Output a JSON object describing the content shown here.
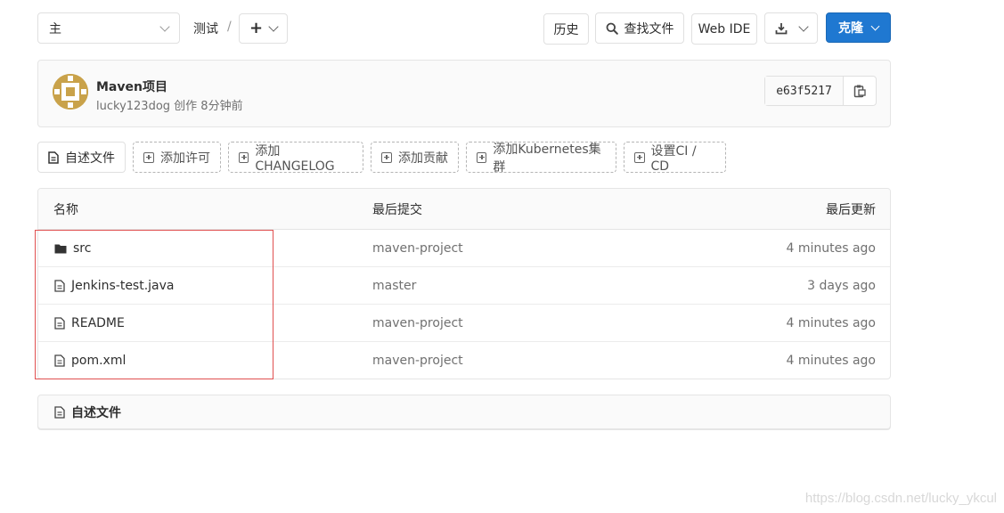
{
  "top_bar": {
    "branch": "主",
    "project_name": "测试",
    "separator": "/",
    "add_label": "+",
    "history_label": "历史",
    "find_file_label": "查找文件",
    "web_ide_label": "Web IDE",
    "clone_label": "克隆"
  },
  "commit": {
    "title": "Maven项目",
    "author": "lucky123dog",
    "meta": "创作 8分钟前",
    "sha": "e63f5217"
  },
  "quick_actions": [
    {
      "label": "自述文件",
      "icon": "file-icon"
    },
    {
      "label": "添加许可",
      "icon": "plus-square-icon"
    },
    {
      "label": "添加CHANGELOG",
      "icon": "plus-square-icon"
    },
    {
      "label": "添加贡献",
      "icon": "plus-square-icon"
    },
    {
      "label": "添加Kubernetes集群",
      "icon": "plus-square-icon"
    },
    {
      "label": "设置CI / CD",
      "icon": "plus-square-icon"
    }
  ],
  "table": {
    "headers": {
      "name": "名称",
      "last_commit": "最后提交",
      "last_update": "最后更新"
    },
    "rows": [
      {
        "name": "src",
        "type": "folder",
        "commit": "maven-project",
        "time": "4 minutes ago"
      },
      {
        "name": "Jenkins-test.java",
        "type": "file",
        "commit": "master",
        "time": "3 days ago"
      },
      {
        "name": "README",
        "type": "file",
        "commit": "maven-project",
        "time": "4 minutes ago"
      },
      {
        "name": "pom.xml",
        "type": "file",
        "commit": "maven-project",
        "time": "4 minutes ago"
      }
    ]
  },
  "readme": {
    "title": "自述文件"
  },
  "watermark": "https://blog.csdn.net/lucky_ykcul",
  "colors": {
    "primary": "#1f78d1",
    "highlight": "#e05050"
  }
}
